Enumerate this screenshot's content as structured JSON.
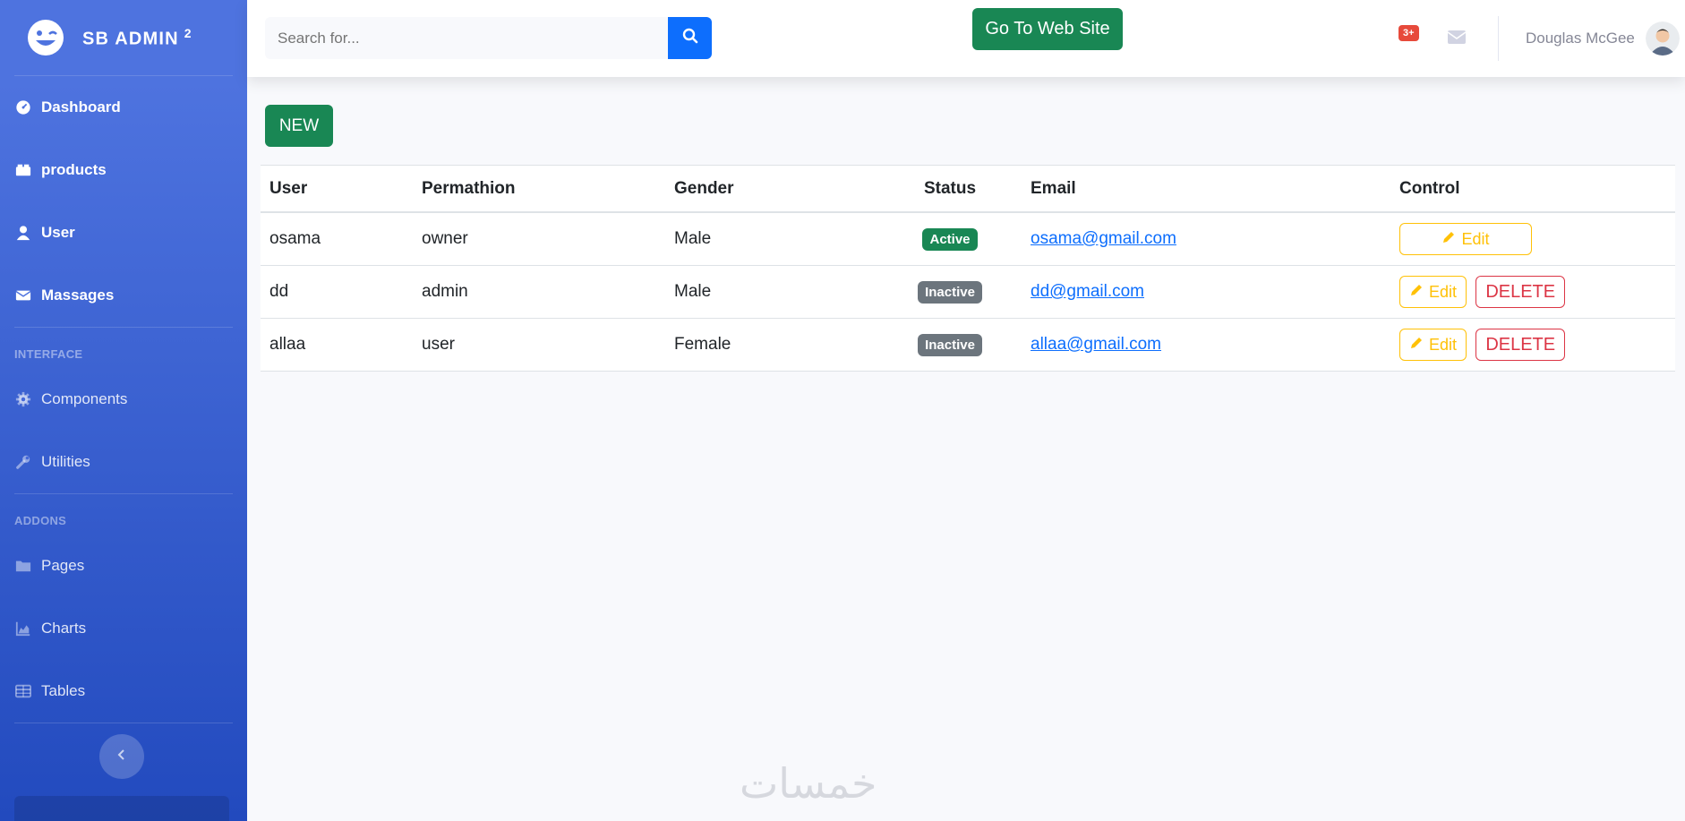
{
  "brand": {
    "name": "SB ADMIN",
    "superscript": "2"
  },
  "sidebar": {
    "items": [
      {
        "label": "Dashboard",
        "icon": "tachometer-icon"
      },
      {
        "label": "products",
        "icon": "boxes-icon"
      },
      {
        "label": "User",
        "icon": "user-icon"
      },
      {
        "label": "Massages",
        "icon": "envelope-icon"
      }
    ],
    "interface_heading": "INTERFACE",
    "interface_items": [
      {
        "label": "Components",
        "icon": "gear-icon"
      },
      {
        "label": "Utilities",
        "icon": "wrench-icon"
      }
    ],
    "addons_heading": "ADDONS",
    "addons_items": [
      {
        "label": "Pages",
        "icon": "folder-icon"
      },
      {
        "label": "Charts",
        "icon": "chart-area-icon"
      },
      {
        "label": "Tables",
        "icon": "table-icon"
      }
    ]
  },
  "topbar": {
    "search_placeholder": "Search for...",
    "goto_label": "Go To Web Site",
    "alert_count": "3+",
    "user_name": "Douglas McGee"
  },
  "main": {
    "new_label": "NEW",
    "columns": [
      "User",
      "Permathion",
      "Gender",
      "Status",
      "Email",
      "Control"
    ],
    "rows": [
      {
        "user": "osama",
        "permission": "owner",
        "gender": "Male",
        "status": "Active",
        "email": "osama@gmail.com",
        "edit": "Edit"
      },
      {
        "user": "dd",
        "permission": "admin",
        "gender": "Male",
        "status": "Inactive",
        "email": "dd@gmail.com",
        "edit": "Edit",
        "delete": "DELETE"
      },
      {
        "user": "allaa",
        "permission": "user",
        "gender": "Female",
        "status": "Inactive",
        "email": "allaa@gmail.com",
        "edit": "Edit",
        "delete": "DELETE"
      }
    ]
  },
  "watermark": "خمسات",
  "colors": {
    "sidebar": "#4e73df",
    "primary": "#0d6efd",
    "success": "#198754",
    "secondary": "#6c757d",
    "warning": "#ffc107",
    "danger": "#dc3545",
    "badge": "#e74a3b"
  }
}
